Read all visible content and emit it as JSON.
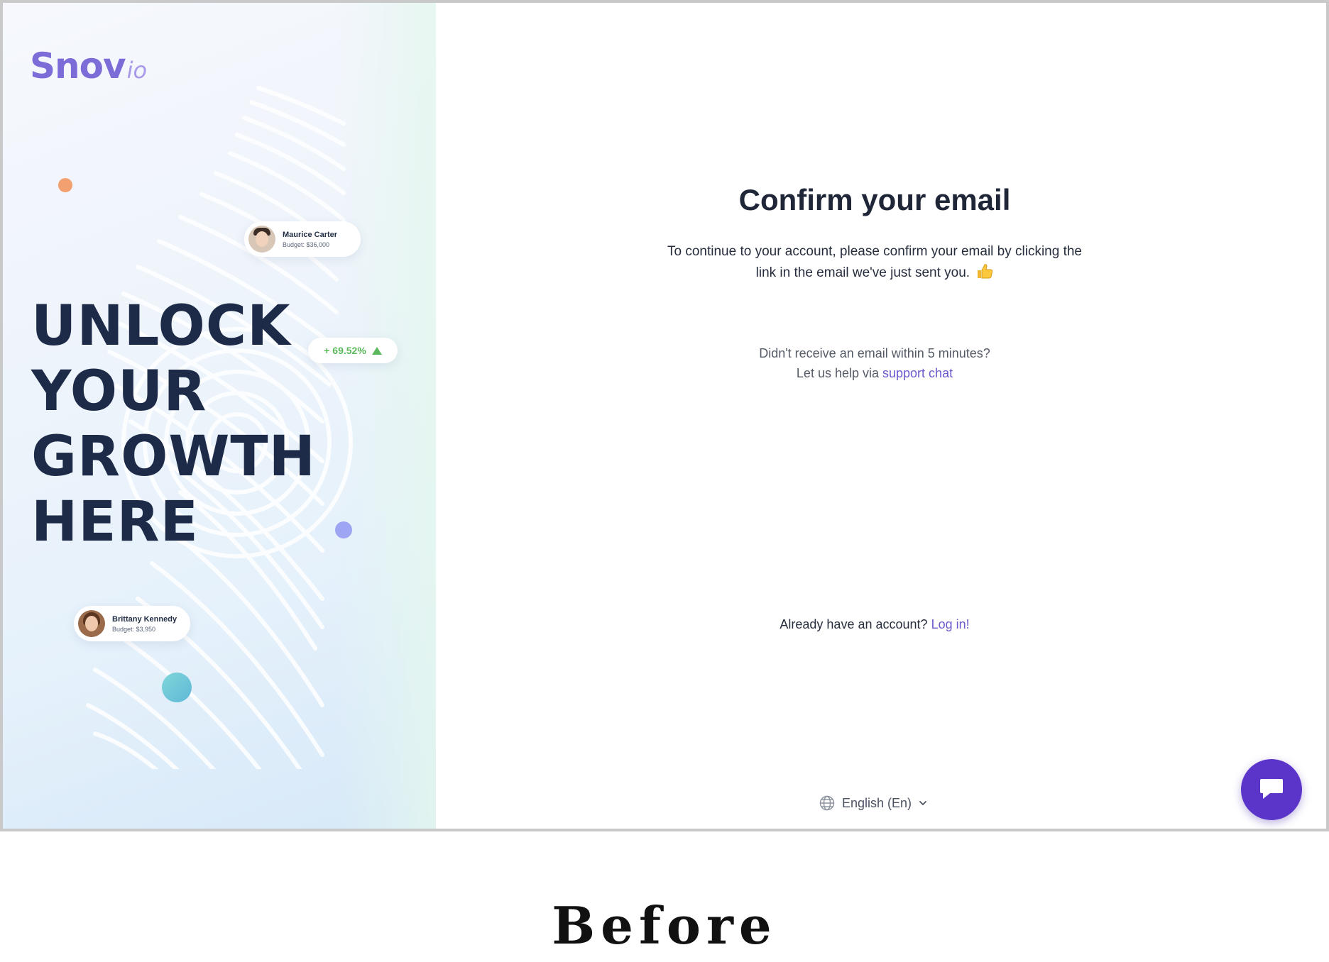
{
  "brand": {
    "name": "Snov",
    "suffix": "io"
  },
  "hero": {
    "lines": [
      "UNLOCK",
      "YOUR",
      "GROWTH",
      "HERE"
    ],
    "growth_badge": "+ 69.52%",
    "cards": [
      {
        "name": "Maurice Carter",
        "budget": "Budget: $36,000"
      },
      {
        "name": "Brittany Kennedy",
        "budget": "Budget: $3,950"
      }
    ]
  },
  "main": {
    "title": "Confirm your email",
    "description_line1": "To continue to your account, please confirm your email by clicking the",
    "description_line2": "link in the email we've just sent you.",
    "help_line1": "Didn't receive an email within 5 minutes?",
    "help_prefix": "Let us help via",
    "support_link": "support chat",
    "already_prefix": "Already have an account?",
    "login_link": "Log in!"
  },
  "language": {
    "selected": "English (En)"
  },
  "caption": "Before",
  "colors": {
    "accent": "#6a5acd",
    "chat_button": "#5b34c9",
    "headline": "#1d2b48",
    "growth": "#5cb85c"
  },
  "icons": {
    "thumb": "thumbs-up-icon",
    "globe": "globe-icon",
    "chevron": "chevron-down-icon",
    "chat": "chat-icon"
  }
}
